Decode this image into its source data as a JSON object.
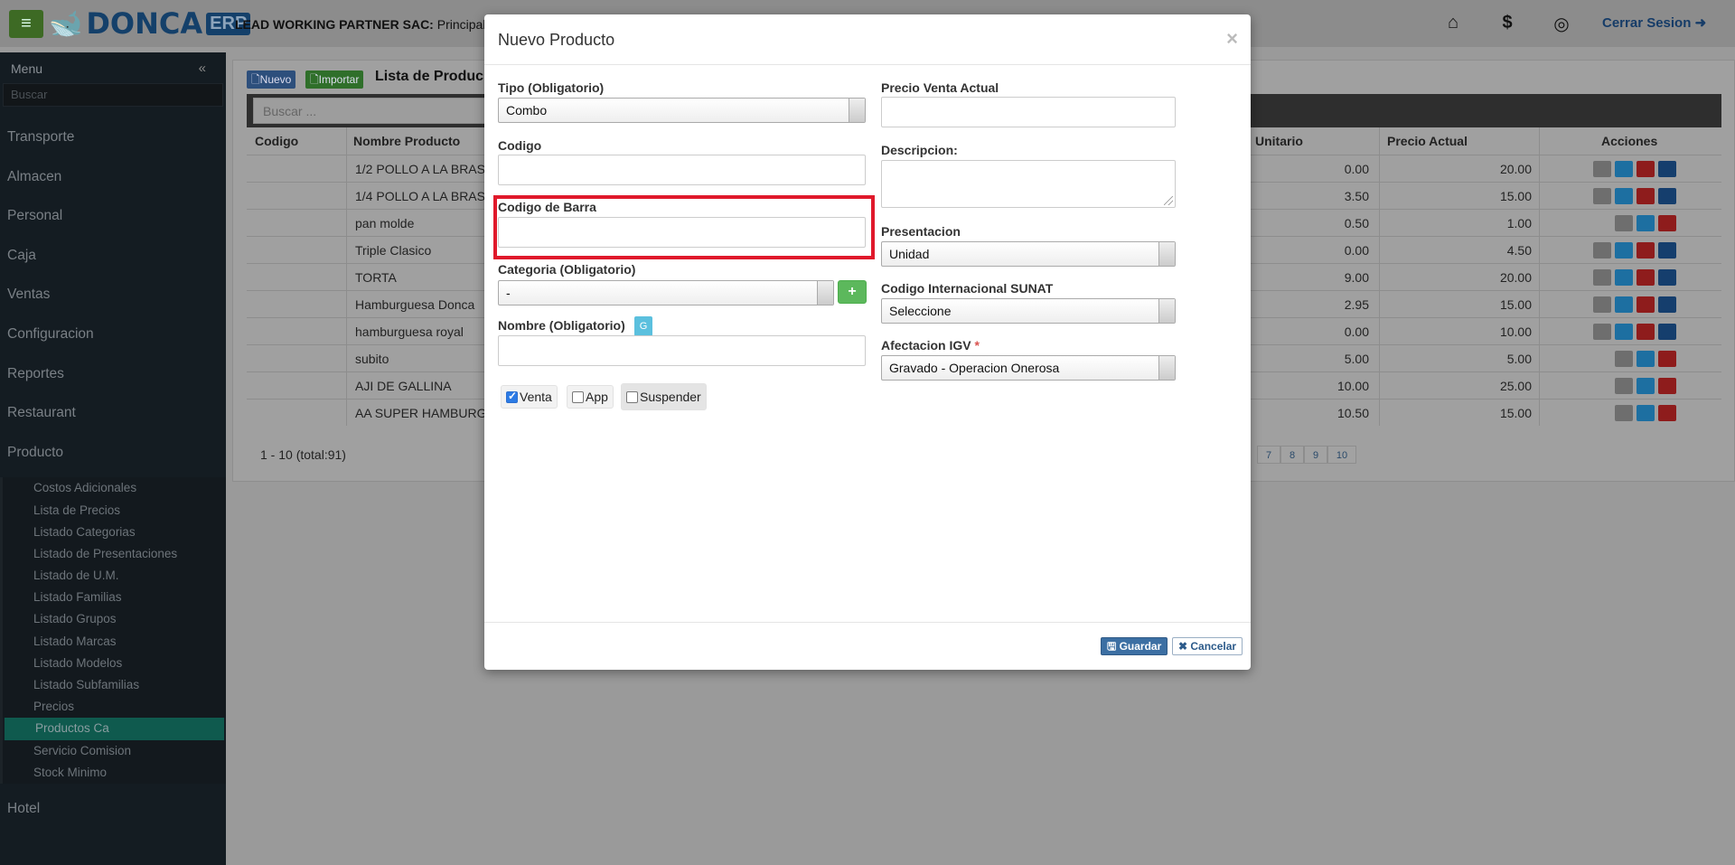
{
  "header": {
    "logo_text": "DONCA",
    "logo_badge": "ERP",
    "company": "LEAD WORKING PARTNER SAC:",
    "branch": "Principal",
    "logout_label": "Cerrar Sesion"
  },
  "sidebar": {
    "title": "Menu",
    "search_placeholder": "Buscar",
    "items": [
      {
        "label": "Transporte"
      },
      {
        "label": "Almacen"
      },
      {
        "label": "Personal"
      },
      {
        "label": "Caja"
      },
      {
        "label": "Ventas"
      },
      {
        "label": "Configuracion"
      },
      {
        "label": "Reportes"
      },
      {
        "label": "Restaurant"
      },
      {
        "label": "Producto"
      }
    ],
    "sub_items": [
      "Costos Adicionales",
      "Lista de Precios",
      "Listado Categorias",
      "Listado de Presentaciones",
      "Listado de U.M.",
      "Listado Familias",
      "Listado Grupos",
      "Listado Marcas",
      "Listado Modelos",
      "Listado Subfamilias",
      "Precios",
      "Productos Ca",
      "Servicio Comision",
      "Stock Minimo"
    ],
    "last_item": "Hotel"
  },
  "list": {
    "new_label": "Nuevo",
    "import_label": "Importar",
    "title": "Lista de Produc",
    "search_placeholder": "Buscar ...",
    "columns": {
      "code": "Codigo",
      "name": "Nombre Producto",
      "unit": "Unitario",
      "price": "Precio Actual",
      "actions": "Acciones"
    },
    "rows": [
      {
        "name": "1/2 POLLO A LA BRAS",
        "unit": "0.00",
        "price": "20.00"
      },
      {
        "name": "1/4 POLLO A LA BRAS",
        "unit": "3.50",
        "price": "15.00"
      },
      {
        "name": "pan molde",
        "unit": "0.50",
        "price": "1.00"
      },
      {
        "name": "Triple Clasico",
        "unit": "0.00",
        "price": "4.50"
      },
      {
        "name": "TORTA",
        "unit": "9.00",
        "price": "20.00"
      },
      {
        "name": "Hamburguesa Donca",
        "unit": "2.95",
        "price": "15.00"
      },
      {
        "name": "hamburguesa royal",
        "unit": "0.00",
        "price": "10.00"
      },
      {
        "name": "subito",
        "unit": "5.00",
        "price": "5.00"
      },
      {
        "name": "AJI DE GALLINA",
        "unit": "10.00",
        "price": "25.00"
      },
      {
        "name": "AA SUPER HAMBURGE",
        "unit": "10.50",
        "price": "15.00"
      }
    ],
    "pager_info": "1 - 10 (total:91)",
    "pages": [
      "7",
      "8",
      "9",
      "10"
    ]
  },
  "modal": {
    "title": "Nuevo Producto",
    "close": "×",
    "tipo_label": "Tipo (Obligatorio)",
    "tipo_value": "Combo",
    "codigo_label": "Codigo",
    "codigo_barra_label": "Codigo de Barra",
    "categoria_label": "Categoria (Obligatorio)",
    "categoria_value": "-",
    "add_label": "+",
    "nombre_label": "Nombre (Obligatorio)",
    "nombre_badge": "G",
    "chk_venta": "Venta",
    "chk_app": "App",
    "chk_suspender": "Suspender",
    "precio_label": "Precio Venta Actual",
    "descripcion_label": "Descripcion:",
    "presentacion_label": "Presentacion",
    "presentacion_value": "Unidad",
    "sunat_label": "Codigo Internacional SUNAT",
    "sunat_value": "Seleccione",
    "igv_label": "Afectacion IGV",
    "igv_required": "*",
    "igv_value": "Gravado - Operacion Onerosa",
    "save_label": "Guardar",
    "cancel_label": "Cancelar"
  },
  "colors": {
    "accent": "#3c6fa3",
    "highlight": "#e0192b",
    "add": "#5cb85c"
  }
}
